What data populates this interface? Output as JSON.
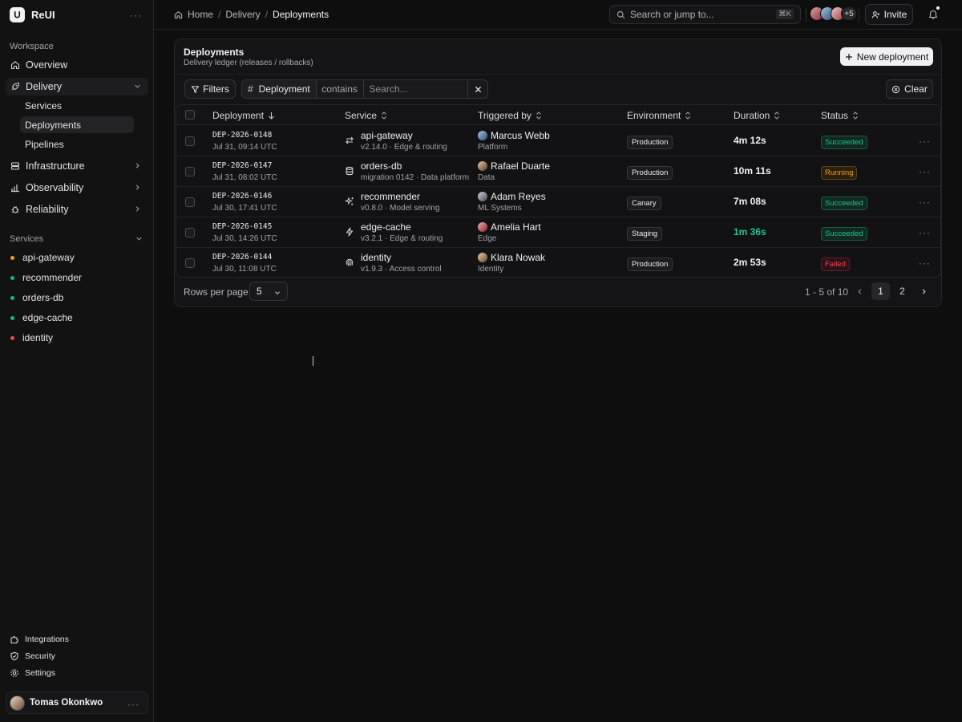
{
  "brand": {
    "name": "ReUI"
  },
  "sidebar": {
    "workspace_label": "Workspace",
    "nav": [
      {
        "label": "Overview",
        "icon": "home-icon"
      },
      {
        "label": "Delivery",
        "icon": "rocket-icon",
        "expanded": true
      },
      {
        "label": "Infrastructure",
        "icon": "server-icon"
      },
      {
        "label": "Observability",
        "icon": "bar-chart-icon"
      },
      {
        "label": "Reliability",
        "icon": "bug-icon"
      }
    ],
    "delivery_sub": [
      {
        "label": "Services"
      },
      {
        "label": "Deployments",
        "active": true
      },
      {
        "label": "Pipelines"
      }
    ],
    "services_label": "Services",
    "services": [
      {
        "label": "api-gateway",
        "color": "#f59e0b"
      },
      {
        "label": "recommender",
        "color": "#10b981"
      },
      {
        "label": "orders-db",
        "color": "#10b981"
      },
      {
        "label": "edge-cache",
        "color": "#10b981"
      },
      {
        "label": "identity",
        "color": "#f0475a"
      }
    ],
    "footer": [
      {
        "label": "Integrations",
        "icon": "puzzle-icon"
      },
      {
        "label": "Security",
        "icon": "shield-icon"
      },
      {
        "label": "Settings",
        "icon": "gear-icon"
      }
    ],
    "user": {
      "name": "Tomas Okonkwo"
    }
  },
  "topbar": {
    "breadcrumb": [
      "Home",
      "Delivery",
      "Deployments"
    ],
    "search_placeholder": "Search or jump to...",
    "search_shortcut": "⌘K",
    "more_avatars": "+5",
    "invite_label": "Invite"
  },
  "card": {
    "title": "Deployments",
    "subtitle": "Delivery ledger (releases / rollbacks)",
    "new_button": "New deployment"
  },
  "filters": {
    "filters_label": "Filters",
    "field": "Deployment",
    "operator": "contains",
    "placeholder": "Search...",
    "clear_label": "Clear"
  },
  "table": {
    "columns": [
      "Deployment",
      "Service",
      "Triggered by",
      "Environment",
      "Duration",
      "Status"
    ],
    "rows": [
      {
        "id": "DEP-2026-0148",
        "time": "Jul 31, 09:14 UTC",
        "service": "api-gateway",
        "service_icon": "arrows-swap-icon",
        "service_sub": "v2.14.0 · Edge & routing",
        "user": "Marcus Webb",
        "team": "Platform",
        "env": "Production",
        "duration": "4m 12s",
        "status": "Succeeded"
      },
      {
        "id": "DEP-2026-0147",
        "time": "Jul 31, 08:02 UTC",
        "service": "orders-db",
        "service_icon": "database-icon",
        "service_sub": "migration 0142 · Data platform",
        "user": "Rafael Duarte",
        "team": "Data",
        "env": "Production",
        "duration": "10m 11s",
        "status": "Running"
      },
      {
        "id": "DEP-2026-0146",
        "time": "Jul 30, 17:41 UTC",
        "service": "recommender",
        "service_icon": "sparkles-icon",
        "service_sub": "v0.8.0 · Model serving",
        "user": "Adam Reyes",
        "team": "ML Systems",
        "env": "Canary",
        "duration": "7m 08s",
        "status": "Succeeded"
      },
      {
        "id": "DEP-2026-0145",
        "time": "Jul 30, 14:26 UTC",
        "service": "edge-cache",
        "service_icon": "lightning-icon",
        "service_sub": "v3.2.1 · Edge & routing",
        "user": "Amelia Hart",
        "team": "Edge",
        "env": "Staging",
        "duration": "1m 36s",
        "status": "Succeeded"
      },
      {
        "id": "DEP-2026-0144",
        "time": "Jul 30, 11:08 UTC",
        "service": "identity",
        "service_icon": "fingerprint-icon",
        "service_sub": "v1.9.3 · Access control",
        "user": "Klara Nowak",
        "team": "Identity",
        "env": "Production",
        "duration": "2m 53s",
        "status": "Failed"
      }
    ]
  },
  "status_colors": {
    "Succeeded": {
      "fg": "#22c38e",
      "bg": "#0f2a20",
      "border": "#1d5a42"
    },
    "Running": {
      "fg": "#f59e0b",
      "bg": "#2b2010",
      "border": "#5a4216"
    },
    "Failed": {
      "fg": "#f0475a",
      "bg": "#2c1216",
      "border": "#5e2029"
    }
  },
  "pagination": {
    "rows_label": "Rows per page",
    "rows_value": "5",
    "range": "1 - 5 of 10",
    "pages": [
      "1",
      "2"
    ],
    "current": "1"
  }
}
